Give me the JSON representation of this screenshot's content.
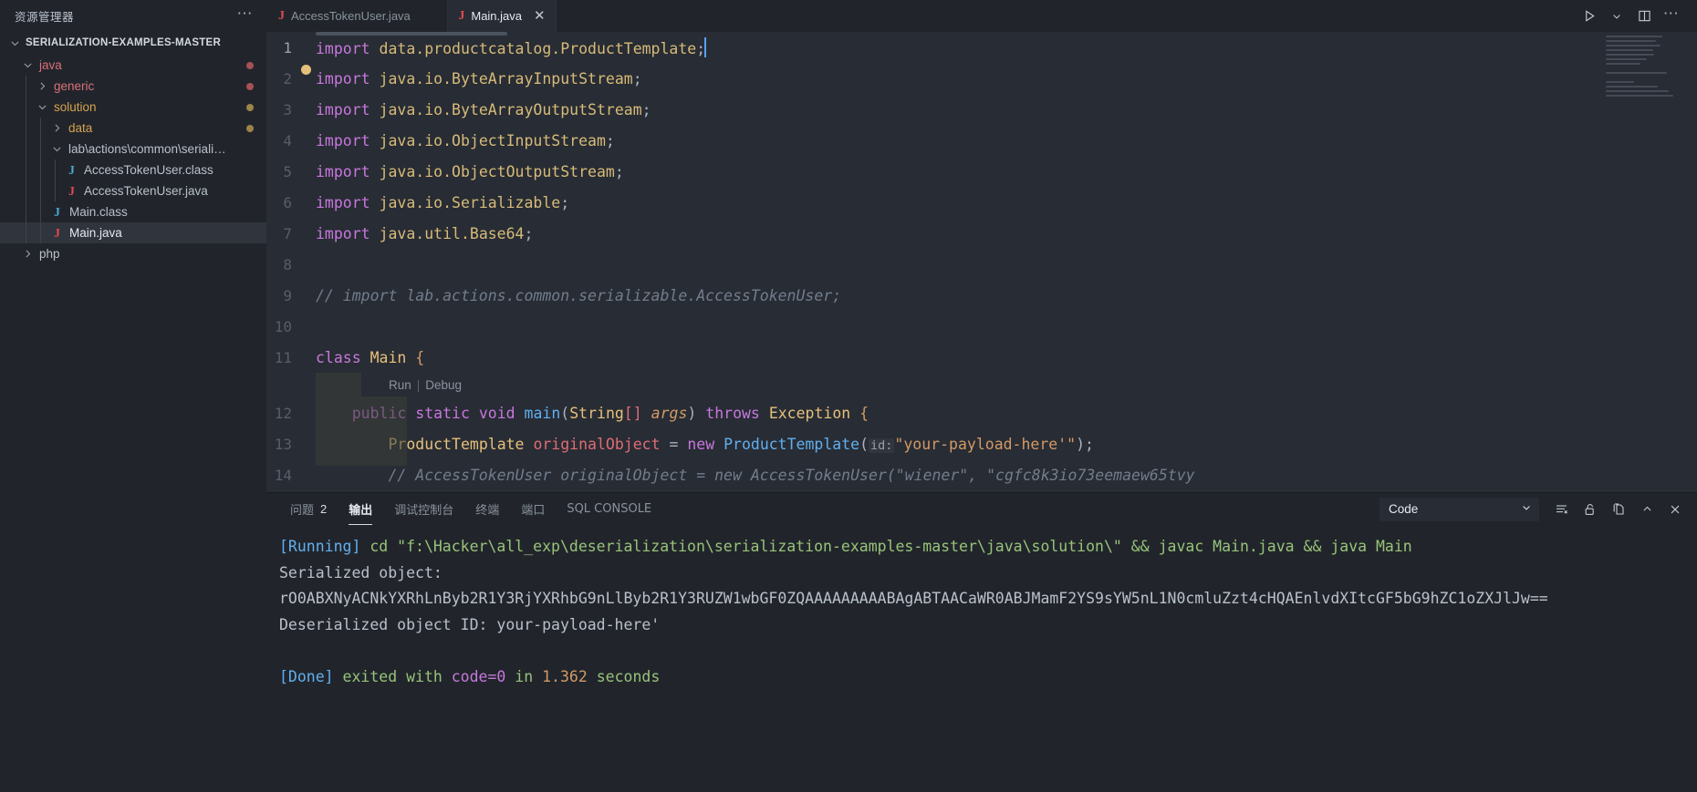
{
  "sidebar": {
    "title": "资源管理器",
    "more_icon": "ellipsis-icon",
    "root_label": "SERIALIZATION-EXAMPLES-MASTER",
    "tree": [
      {
        "label": "java",
        "kind": "folder",
        "state": "expanded",
        "color": "folder-java",
        "depth": 1,
        "dot": "red"
      },
      {
        "label": "generic",
        "kind": "folder",
        "state": "collapsed",
        "color": "folder-generic",
        "depth": 2,
        "dot": "red"
      },
      {
        "label": "solution",
        "kind": "folder",
        "state": "expanded",
        "color": "folder-solution",
        "depth": 2,
        "dot": "yellow"
      },
      {
        "label": "data",
        "kind": "folder",
        "state": "collapsed",
        "color": "folder-data",
        "depth": 3,
        "dot": "yellow"
      },
      {
        "label": "lab\\actions\\common\\seriali…",
        "kind": "folder",
        "state": "expanded",
        "color": "plain",
        "depth": 3,
        "dot": ""
      },
      {
        "label": "AccessTokenUser.class",
        "kind": "file",
        "icon": "java-class-icon",
        "icon_color": "blue",
        "color": "dim",
        "depth": 4,
        "dot": ""
      },
      {
        "label": "AccessTokenUser.java",
        "kind": "file",
        "icon": "java-file-icon",
        "icon_color": "red",
        "color": "dim",
        "depth": 4,
        "dot": ""
      },
      {
        "label": "Main.class",
        "kind": "file",
        "icon": "java-class-icon",
        "icon_color": "blue",
        "color": "dim",
        "depth": 3,
        "dot": ""
      },
      {
        "label": "Main.java",
        "kind": "file",
        "icon": "java-file-icon",
        "icon_color": "red",
        "color": "white",
        "depth": 3,
        "dot": "",
        "selected": true
      },
      {
        "label": "php",
        "kind": "folder",
        "state": "collapsed",
        "color": "plain",
        "depth": 1,
        "dot": ""
      }
    ]
  },
  "tabs": [
    {
      "label": "AccessTokenUser.java",
      "icon": "java-file-icon",
      "active": false
    },
    {
      "label": "Main.java",
      "icon": "java-file-icon",
      "active": true
    }
  ],
  "editor_actions": [
    {
      "name": "run-button",
      "icon": "play-icon"
    },
    {
      "name": "run-options-dropdown",
      "icon": "chevron-down-icon"
    },
    {
      "name": "split-editor-button",
      "icon": "split-editor-icon"
    },
    {
      "name": "more-actions-button",
      "icon": "ellipsis-icon"
    }
  ],
  "code": {
    "lines": [
      {
        "n": "1",
        "tokens": [
          {
            "t": "import",
            "c": "k"
          },
          {
            "t": " ",
            "c": "p"
          },
          {
            "t": "data.productcatalog.ProductTemplate",
            "c": "id"
          },
          {
            "t": ";",
            "c": "p"
          }
        ],
        "cursor": true
      },
      {
        "n": "2",
        "tokens": [
          {
            "t": "import",
            "c": "k"
          },
          {
            "t": " ",
            "c": "p"
          },
          {
            "t": "java.io.ByteArrayInputStream",
            "c": "id"
          },
          {
            "t": ";",
            "c": "p"
          }
        ],
        "lightbulb": true
      },
      {
        "n": "3",
        "tokens": [
          {
            "t": "import",
            "c": "k"
          },
          {
            "t": " ",
            "c": "p"
          },
          {
            "t": "java.io.ByteArrayOutputStream",
            "c": "id"
          },
          {
            "t": ";",
            "c": "p"
          }
        ]
      },
      {
        "n": "4",
        "tokens": [
          {
            "t": "import",
            "c": "k"
          },
          {
            "t": " ",
            "c": "p"
          },
          {
            "t": "java.io.ObjectInputStream",
            "c": "id"
          },
          {
            "t": ";",
            "c": "p"
          }
        ]
      },
      {
        "n": "5",
        "tokens": [
          {
            "t": "import",
            "c": "k"
          },
          {
            "t": " ",
            "c": "p"
          },
          {
            "t": "java.io.ObjectOutputStream",
            "c": "id"
          },
          {
            "t": ";",
            "c": "p"
          }
        ]
      },
      {
        "n": "6",
        "tokens": [
          {
            "t": "import",
            "c": "k"
          },
          {
            "t": " ",
            "c": "p"
          },
          {
            "t": "java.io.Serializable",
            "c": "id"
          },
          {
            "t": ";",
            "c": "p"
          }
        ]
      },
      {
        "n": "7",
        "tokens": [
          {
            "t": "import",
            "c": "k"
          },
          {
            "t": " ",
            "c": "p"
          },
          {
            "t": "java.util.Base64",
            "c": "id"
          },
          {
            "t": ";",
            "c": "p"
          }
        ]
      },
      {
        "n": "8",
        "tokens": []
      },
      {
        "n": "9",
        "tokens": [
          {
            "t": "// import lab.actions.common.serializable.AccessTokenUser;",
            "c": "cm"
          }
        ]
      },
      {
        "n": "10",
        "tokens": []
      },
      {
        "n": "11",
        "tokens": [
          {
            "t": "class",
            "c": "k"
          },
          {
            "t": " ",
            "c": "p"
          },
          {
            "t": "Main",
            "c": "ty"
          },
          {
            "t": " ",
            "c": "p"
          },
          {
            "t": "{",
            "c": "br1"
          }
        ]
      },
      {
        "n": "12",
        "tokens": [
          {
            "t": "    ",
            "c": "p"
          },
          {
            "t": "public",
            "c": "k"
          },
          {
            "t": " ",
            "c": "p"
          },
          {
            "t": "static",
            "c": "k"
          },
          {
            "t": " ",
            "c": "p"
          },
          {
            "t": "void",
            "c": "k"
          },
          {
            "t": " ",
            "c": "p"
          },
          {
            "t": "main",
            "c": "fn"
          },
          {
            "t": "(",
            "c": "p"
          },
          {
            "t": "String",
            "c": "ty"
          },
          {
            "t": "[]",
            "c": "va"
          },
          {
            "t": " ",
            "c": "p"
          },
          {
            "t": "args",
            "c": "pa"
          },
          {
            "t": ")",
            "c": "p"
          },
          {
            "t": " ",
            "c": "p"
          },
          {
            "t": "throws",
            "c": "k"
          },
          {
            "t": " ",
            "c": "p"
          },
          {
            "t": "Exception",
            "c": "ty"
          },
          {
            "t": " ",
            "c": "p"
          },
          {
            "t": "{",
            "c": "br1"
          }
        ]
      },
      {
        "n": "13",
        "tokens": [
          {
            "t": "        ",
            "c": "p"
          },
          {
            "t": "ProductTemplate",
            "c": "ty"
          },
          {
            "t": " ",
            "c": "p"
          },
          {
            "t": "originalObject",
            "c": "va"
          },
          {
            "t": " ",
            "c": "p"
          },
          {
            "t": "=",
            "c": "p"
          },
          {
            "t": " ",
            "c": "p"
          },
          {
            "t": "new",
            "c": "k"
          },
          {
            "t": " ",
            "c": "p"
          },
          {
            "t": "ProductTemplate",
            "c": "fn"
          },
          {
            "t": "(",
            "c": "p"
          },
          {
            "t": "id:",
            "c": "inlay"
          },
          {
            "t": "\"your-payload-here'\"",
            "c": "st"
          },
          {
            "t": ")",
            "c": "p"
          },
          {
            "t": ";",
            "c": "p"
          }
        ]
      },
      {
        "n": "14",
        "tokens": [
          {
            "t": "        // AccessTokenUser originalObject = new AccessTokenUser(\"wiener\", \"cgfc8k3io73eemaew65tvy",
            "c": "cm"
          }
        ]
      }
    ],
    "codelens": {
      "run_label": "Run",
      "separator": "|",
      "debug_label": "Debug"
    }
  },
  "panel": {
    "tabs": [
      {
        "label": "问题",
        "badge": "2",
        "active": false
      },
      {
        "label": "输出",
        "badge": "",
        "active": true
      },
      {
        "label": "调试控制台",
        "badge": "",
        "active": false
      },
      {
        "label": "终端",
        "badge": "",
        "active": false
      },
      {
        "label": "端口",
        "badge": "",
        "active": false
      },
      {
        "label": "SQL CONSOLE",
        "badge": "",
        "active": false
      }
    ],
    "channel": {
      "value": "Code",
      "chevron": "chevron-down-icon"
    },
    "actions": [
      {
        "name": "clear-output-button",
        "icon": "clear-output-icon"
      },
      {
        "name": "toggle-lock-button",
        "icon": "unlock-icon"
      },
      {
        "name": "open-in-editor-button",
        "icon": "new-window-icon"
      },
      {
        "name": "maximize-panel-button",
        "icon": "chevron-up-icon"
      },
      {
        "name": "close-panel-button",
        "icon": "close-icon"
      }
    ],
    "output": [
      {
        "segs": [
          {
            "t": "[Running]",
            "c": "o-blue"
          },
          {
            "t": " cd \"f:\\Hacker\\all_exp\\deserialization\\serialization-examples-master\\java\\solution\\\" && javac Main.java && java Main",
            "c": "o-green"
          }
        ]
      },
      {
        "segs": [
          {
            "t": "Serialized object:",
            "c": "o-gray"
          }
        ]
      },
      {
        "segs": [
          {
            "t": "rO0ABXNyACNkYXRhLnByb2R1Y3RjYXRhbG9nLlByb2R1Y3RUZW1wbGF0ZQAAAAAAAAABAgABTAACaWR0ABJMamF2YS9sYW5nL1N0cmluZzt4cHQAEnlvdXItcGF5bG9hZC1oZXJlJw==",
            "c": "o-gray"
          }
        ]
      },
      {
        "segs": [
          {
            "t": "Deserialized object ID: your-payload-here'",
            "c": "o-gray"
          }
        ]
      },
      {
        "segs": [
          {
            "t": "",
            "c": "o-gray"
          }
        ]
      },
      {
        "segs": [
          {
            "t": "[Done]",
            "c": "o-blue"
          },
          {
            "t": " exited with ",
            "c": "o-green"
          },
          {
            "t": "code=0",
            "c": "o-mag"
          },
          {
            "t": " in ",
            "c": "o-green"
          },
          {
            "t": "1.362",
            "c": "o-org"
          },
          {
            "t": " seconds",
            "c": "o-green"
          }
        ]
      }
    ]
  },
  "colors": {
    "editor_bg": "#282c34",
    "chrome_bg": "#21252b",
    "selection": "#2f343d",
    "accent": "#61afef",
    "string": "#d19a66",
    "keyword": "#c678dd",
    "type": "#e5c07b",
    "comment": "#727d8c",
    "success": "#98c379"
  }
}
